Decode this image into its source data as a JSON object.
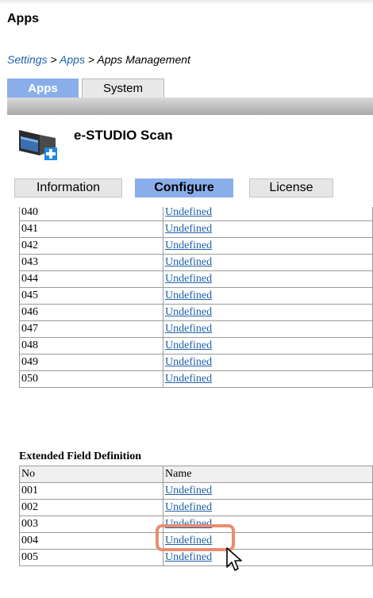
{
  "app": {
    "title": "Apps"
  },
  "breadcrumb": {
    "settings": "Settings",
    "sep1": " > ",
    "apps": "Apps",
    "sep2": " > ",
    "current": "Apps Management"
  },
  "top_tabs": [
    {
      "label": "Apps",
      "active": true
    },
    {
      "label": "System",
      "active": false
    }
  ],
  "app_info": {
    "name": "e-STUDIO Scan",
    "icon": "scanner-icon"
  },
  "sub_tabs": [
    {
      "label": "Information",
      "active": false
    },
    {
      "label": "Configure",
      "active": true
    },
    {
      "label": "License",
      "active": false
    }
  ],
  "field_table": {
    "rows": [
      {
        "no": "040",
        "name": "Undefined"
      },
      {
        "no": "041",
        "name": "Undefined"
      },
      {
        "no": "042",
        "name": "Undefined"
      },
      {
        "no": "043",
        "name": "Undefined"
      },
      {
        "no": "044",
        "name": "Undefined"
      },
      {
        "no": "045",
        "name": "Undefined"
      },
      {
        "no": "046",
        "name": "Undefined"
      },
      {
        "no": "047",
        "name": "Undefined"
      },
      {
        "no": "048",
        "name": "Undefined"
      },
      {
        "no": "049",
        "name": "Undefined"
      },
      {
        "no": "050",
        "name": "Undefined"
      }
    ]
  },
  "extended": {
    "title": "Extended Field Definition",
    "headers": {
      "no": "No",
      "name": "Name"
    },
    "rows": [
      {
        "no": "001",
        "name": "Undefined"
      },
      {
        "no": "002",
        "name": "Undefined"
      },
      {
        "no": "003",
        "name": "Undefined"
      },
      {
        "no": "004",
        "name": "Undefined"
      },
      {
        "no": "005",
        "name": "Undefined"
      }
    ]
  },
  "colors": {
    "active_tab": "#8aaeea",
    "link": "#1f5fa8",
    "highlight": "#e98d6f"
  }
}
